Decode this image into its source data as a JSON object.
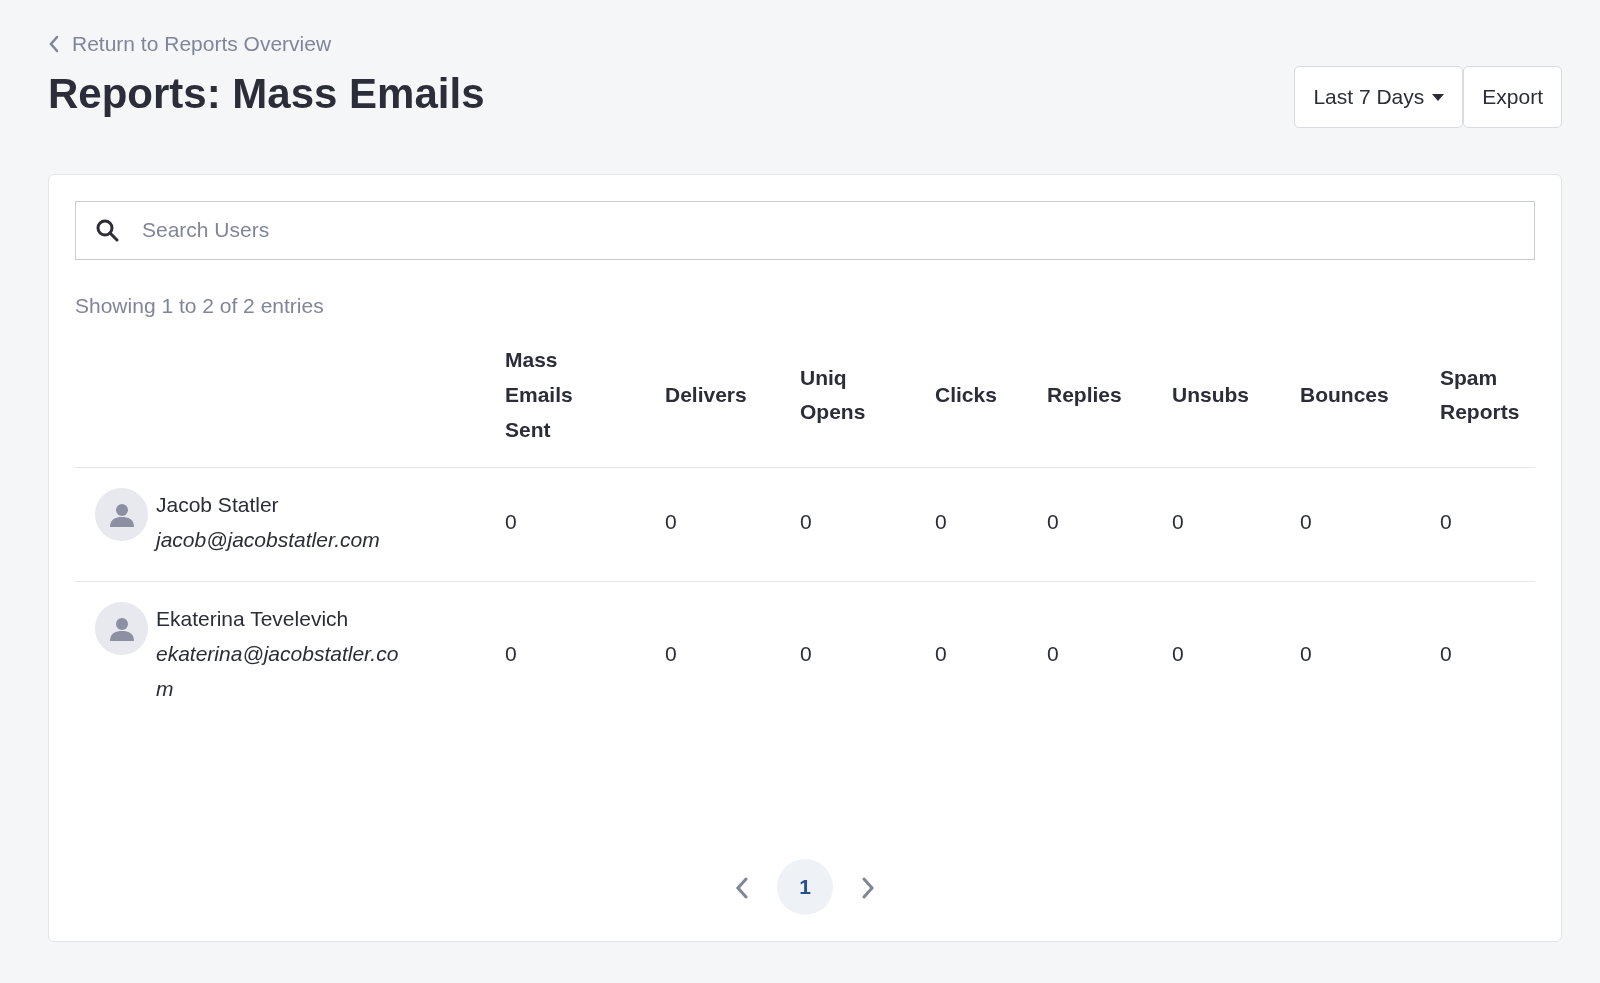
{
  "back_link": "Return to Reports Overview",
  "title": "Reports: Mass Emails",
  "actions": {
    "range": "Last 7 Days",
    "export": "Export"
  },
  "search": {
    "placeholder": "Search Users"
  },
  "summary": "Showing 1 to 2 of 2 entries",
  "table": {
    "columns": [
      "",
      "Mass Emails Sent",
      "Delivers",
      "Uniq Opens",
      "Clicks",
      "Replies",
      "Unsubs",
      "Bounces",
      "Spam Reports"
    ],
    "rows": [
      {
        "name": "Jacob Statler",
        "email": "jacob@jacobstatler.com",
        "values": [
          "0",
          "0",
          "0",
          "0",
          "0",
          "0",
          "0",
          "0"
        ]
      },
      {
        "name": "Ekaterina Tevelevich",
        "email": "ekaterina@jacobstatler.com",
        "values": [
          "0",
          "0",
          "0",
          "0",
          "0",
          "0",
          "0",
          "0"
        ]
      }
    ]
  },
  "pagination": {
    "pages": [
      {
        "label": "1",
        "selected": true
      }
    ]
  }
}
